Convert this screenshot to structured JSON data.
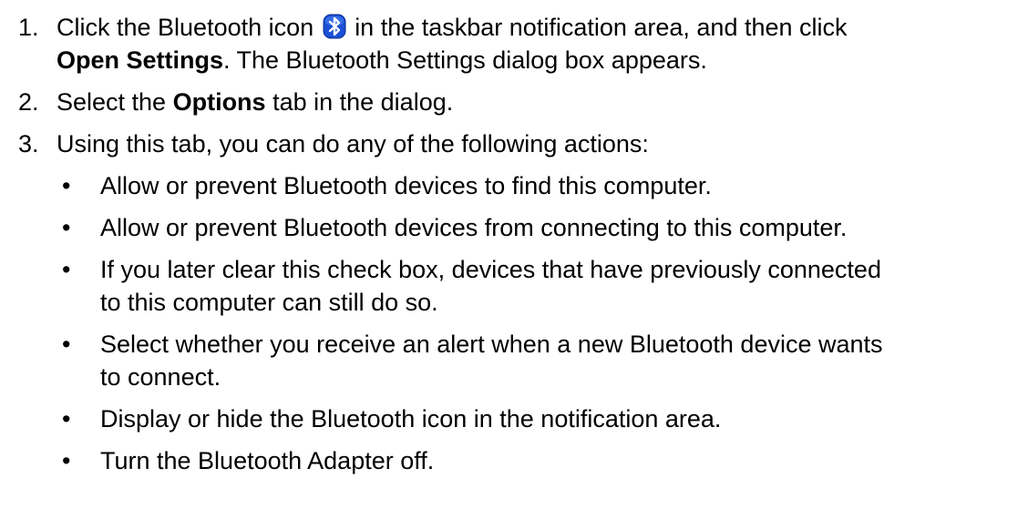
{
  "steps": [
    {
      "number": "1.",
      "line1_a": "Click the Bluetooth icon",
      "line1_b": "in the taskbar notification area, and then click",
      "line2_bold": "Open Settings",
      "line2_rest": ". The Bluetooth Settings dialog box appears."
    },
    {
      "number": "2.",
      "pre": "Select the ",
      "bold": "Options",
      "post": " tab in the dialog."
    },
    {
      "number": "3.",
      "text": "Using this tab, you can do any of the following actions:"
    }
  ],
  "bullets": [
    {
      "lines": [
        "Allow or prevent Bluetooth devices to find this computer."
      ]
    },
    {
      "lines": [
        "Allow or prevent Bluetooth devices from connecting to this computer."
      ]
    },
    {
      "lines": [
        "If you later clear this check box, devices that have previously connected",
        "to this computer can still do so."
      ]
    },
    {
      "lines": [
        "Select whether you receive an alert when a new Bluetooth device wants",
        "to connect."
      ]
    },
    {
      "lines": [
        "Display or hide the Bluetooth icon in the notification area."
      ]
    },
    {
      "lines": [
        "Turn the Bluetooth Adapter off."
      ]
    }
  ],
  "bullet_symbol": "•",
  "icons": {
    "bluetooth": "bluetooth-icon",
    "bluetooth_color": "#1a4fd6"
  }
}
